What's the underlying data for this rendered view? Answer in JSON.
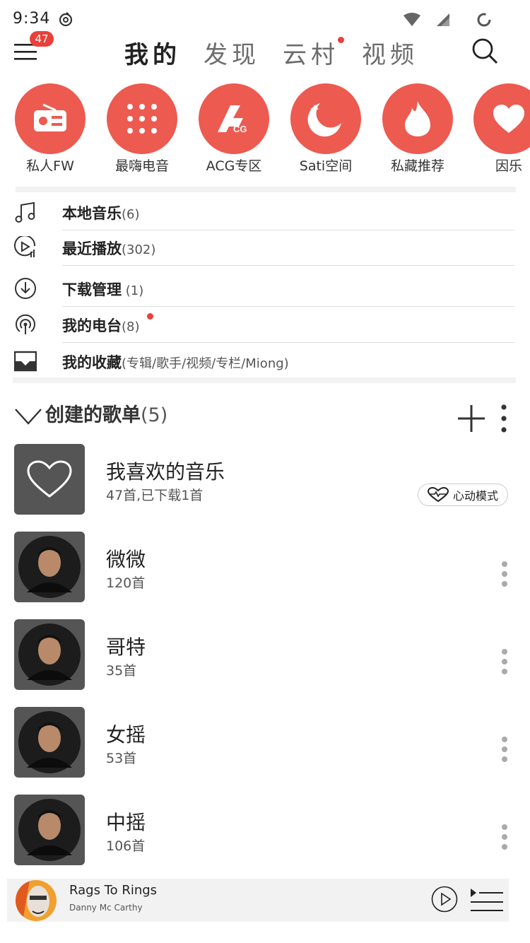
{
  "status": {
    "time": "9:34"
  },
  "nav": {
    "badge": "47",
    "tabs": [
      "我的",
      "发现",
      "云村",
      "视频"
    ]
  },
  "shortcuts": [
    {
      "label": "私人FW",
      "icon": "radio-icon"
    },
    {
      "label": "最嗨电音",
      "icon": "dots-grid-icon"
    },
    {
      "label": "ACG专区",
      "icon": "acg-icon"
    },
    {
      "label": "Sati空间",
      "icon": "moon-icon"
    },
    {
      "label": "私藏推荐",
      "icon": "flame-icon"
    },
    {
      "label": "因乐",
      "icon": "heart-icon"
    }
  ],
  "menu": [
    {
      "label": "本地音乐",
      "count": "(6)",
      "icon": "music-note-icon"
    },
    {
      "label": "最近播放",
      "count": "(302)",
      "icon": "recent-play-icon"
    },
    {
      "label": "下载管理",
      "count": " (1)",
      "icon": "download-icon"
    },
    {
      "label": "我的电台",
      "count": "(8)",
      "icon": "podcast-icon"
    },
    {
      "label": "我的收藏",
      "count": "(专辑/歌手/视频/专栏/Miong)",
      "icon": "collection-icon"
    }
  ],
  "playlists_header": {
    "title": "创建的歌单",
    "count": "(5)"
  },
  "playlists": [
    {
      "name": "我喜欢的音乐",
      "sub": "47首,已下载1首",
      "mode_label": "心动模式"
    },
    {
      "name": "微微",
      "sub": "120首"
    },
    {
      "name": "哥特",
      "sub": "35首"
    },
    {
      "name": "女摇",
      "sub": "53首"
    },
    {
      "name": "中摇",
      "sub": "106首"
    }
  ],
  "player": {
    "title": "Rags To Rings",
    "artist": "Danny Mc Carthy"
  },
  "colors": {
    "accent": "#e9403a",
    "shortcut_bg": "#ed5a50"
  }
}
